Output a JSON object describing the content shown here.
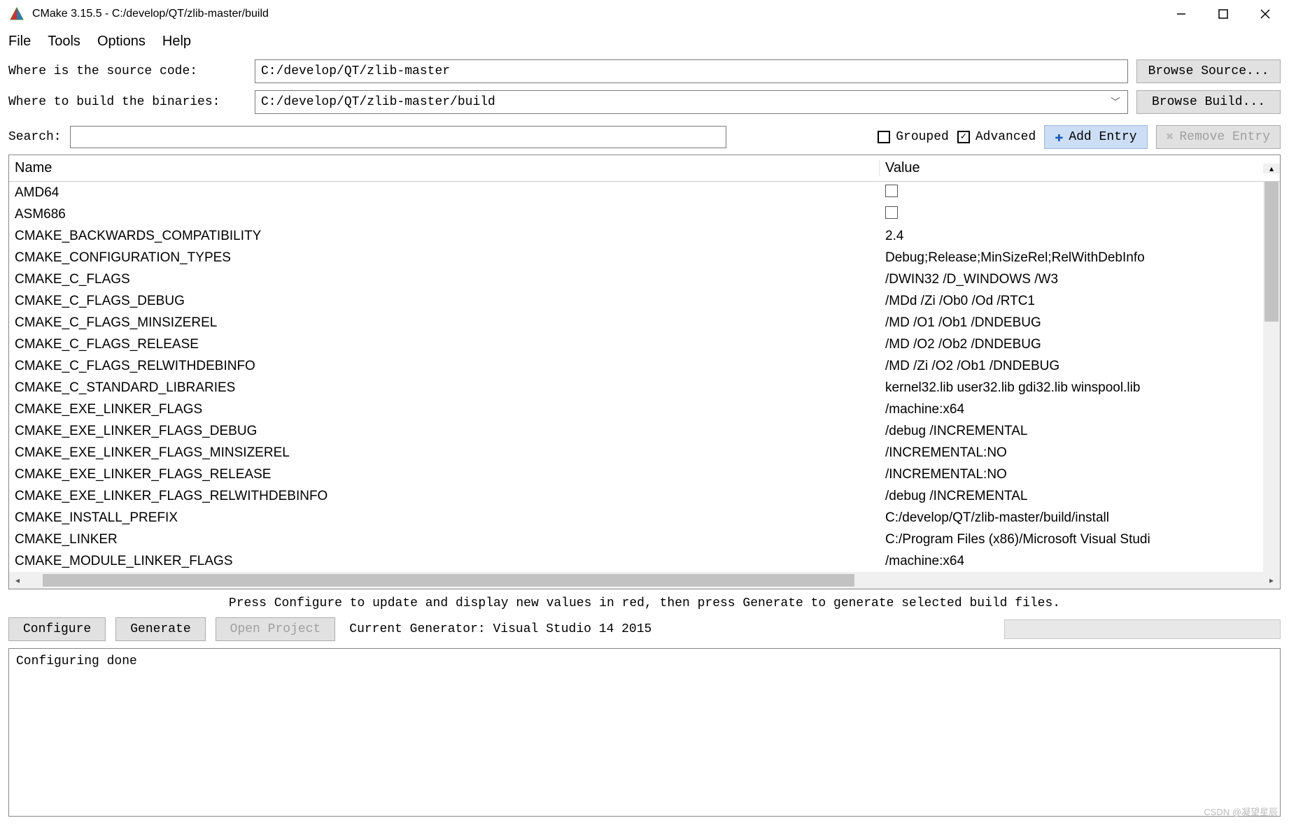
{
  "titlebar": {
    "title": "CMake 3.15.5 - C:/develop/QT/zlib-master/build"
  },
  "menubar": [
    "File",
    "Tools",
    "Options",
    "Help"
  ],
  "paths": {
    "source_label": "Where is the source code:",
    "source_value": "C:/develop/QT/zlib-master",
    "browse_source": "Browse Source...",
    "build_label": "Where to build the binaries:",
    "build_value": "C:/develop/QT/zlib-master/build",
    "browse_build": "Browse Build..."
  },
  "toolbar": {
    "search_label": "Search:",
    "search_value": "",
    "grouped_label": "Grouped",
    "grouped_checked": false,
    "advanced_label": "Advanced",
    "advanced_checked": true,
    "add_entry": "Add Entry",
    "remove_entry": "Remove Entry"
  },
  "grid": {
    "col_name": "Name",
    "col_value": "Value",
    "rows": [
      {
        "name": "AMD64",
        "type": "bool",
        "value": false
      },
      {
        "name": "ASM686",
        "type": "bool",
        "value": false
      },
      {
        "name": "CMAKE_BACKWARDS_COMPATIBILITY",
        "type": "text",
        "value": "2.4"
      },
      {
        "name": "CMAKE_CONFIGURATION_TYPES",
        "type": "text",
        "value": "Debug;Release;MinSizeRel;RelWithDebInfo"
      },
      {
        "name": "CMAKE_C_FLAGS",
        "type": "text",
        "value": "/DWIN32 /D_WINDOWS /W3"
      },
      {
        "name": "CMAKE_C_FLAGS_DEBUG",
        "type": "text",
        "value": "/MDd /Zi /Ob0 /Od /RTC1"
      },
      {
        "name": "CMAKE_C_FLAGS_MINSIZEREL",
        "type": "text",
        "value": "/MD /O1 /Ob1 /DNDEBUG"
      },
      {
        "name": "CMAKE_C_FLAGS_RELEASE",
        "type": "text",
        "value": "/MD /O2 /Ob2 /DNDEBUG"
      },
      {
        "name": "CMAKE_C_FLAGS_RELWITHDEBINFO",
        "type": "text",
        "value": "/MD /Zi /O2 /Ob1 /DNDEBUG"
      },
      {
        "name": "CMAKE_C_STANDARD_LIBRARIES",
        "type": "text",
        "value": "kernel32.lib user32.lib gdi32.lib winspool.lib"
      },
      {
        "name": "CMAKE_EXE_LINKER_FLAGS",
        "type": "text",
        "value": "/machine:x64"
      },
      {
        "name": "CMAKE_EXE_LINKER_FLAGS_DEBUG",
        "type": "text",
        "value": "/debug /INCREMENTAL"
      },
      {
        "name": "CMAKE_EXE_LINKER_FLAGS_MINSIZEREL",
        "type": "text",
        "value": "/INCREMENTAL:NO"
      },
      {
        "name": "CMAKE_EXE_LINKER_FLAGS_RELEASE",
        "type": "text",
        "value": "/INCREMENTAL:NO"
      },
      {
        "name": "CMAKE_EXE_LINKER_FLAGS_RELWITHDEBINFO",
        "type": "text",
        "value": "/debug /INCREMENTAL"
      },
      {
        "name": "CMAKE_INSTALL_PREFIX",
        "type": "text",
        "value": "C:/develop/QT/zlib-master/build/install"
      },
      {
        "name": "CMAKE_LINKER",
        "type": "text",
        "value": "C:/Program Files (x86)/Microsoft Visual Studi"
      },
      {
        "name": "CMAKE_MODULE_LINKER_FLAGS",
        "type": "text",
        "value": "/machine:x64"
      }
    ]
  },
  "hint": "Press Configure to update and display new values in red, then press Generate to generate selected build files.",
  "bottom": {
    "configure": "Configure",
    "generate": "Generate",
    "open_project": "Open Project",
    "generator_text": "Current Generator: Visual Studio 14 2015"
  },
  "output": "Configuring done",
  "watermark": "CSDN @凝望星辰"
}
